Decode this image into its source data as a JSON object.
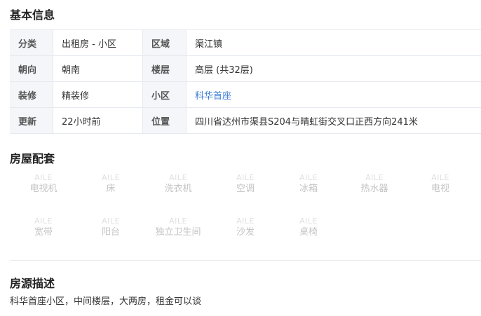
{
  "basic_info": {
    "title": "基本信息",
    "rows": [
      {
        "k1": "分类",
        "v1": "出租房 - 小区",
        "k2": "区域",
        "v2": "渠江镇"
      },
      {
        "k1": "朝向",
        "v1": "朝南",
        "k2": "楼层",
        "v2": "高层 (共32层)"
      },
      {
        "k1": "装修",
        "v1": "精装修",
        "k2": "小区",
        "v2": "科华首座"
      },
      {
        "k1": "更新",
        "v1": "22小时前",
        "k2": "位置",
        "v2": "四川省达州市渠县S204与晴虹街交叉口正西方向241米"
      }
    ]
  },
  "facilities": {
    "title": "房屋配套",
    "logo_text": "AILE",
    "items": [
      {
        "label": "电视机",
        "icon": "tv-icon"
      },
      {
        "label": "床",
        "icon": "bed-icon"
      },
      {
        "label": "洗衣机",
        "icon": "washing-machine-icon"
      },
      {
        "label": "空调",
        "icon": "air-conditioner-icon"
      },
      {
        "label": "冰箱",
        "icon": "fridge-icon"
      },
      {
        "label": "热水器",
        "icon": "water-heater-icon"
      },
      {
        "label": "电视",
        "icon": "tv-icon"
      },
      {
        "label": "宽带",
        "icon": "broadband-icon"
      },
      {
        "label": "阳台",
        "icon": "balcony-icon"
      },
      {
        "label": "独立卫生间",
        "icon": "bathroom-icon"
      },
      {
        "label": "沙发",
        "icon": "sofa-icon"
      },
      {
        "label": "桌椅",
        "icon": "table-chair-icon"
      }
    ],
    "available": false
  },
  "description": {
    "title": "房源描述",
    "text": "科华首座小区，中间楼层，大两房，租金可以谈"
  },
  "colors": {
    "link": "#3a7bd5",
    "key_cell_bg": "#f4f6f9",
    "border": "#e6e9ee",
    "disabled_text": "#c4c4c4"
  }
}
